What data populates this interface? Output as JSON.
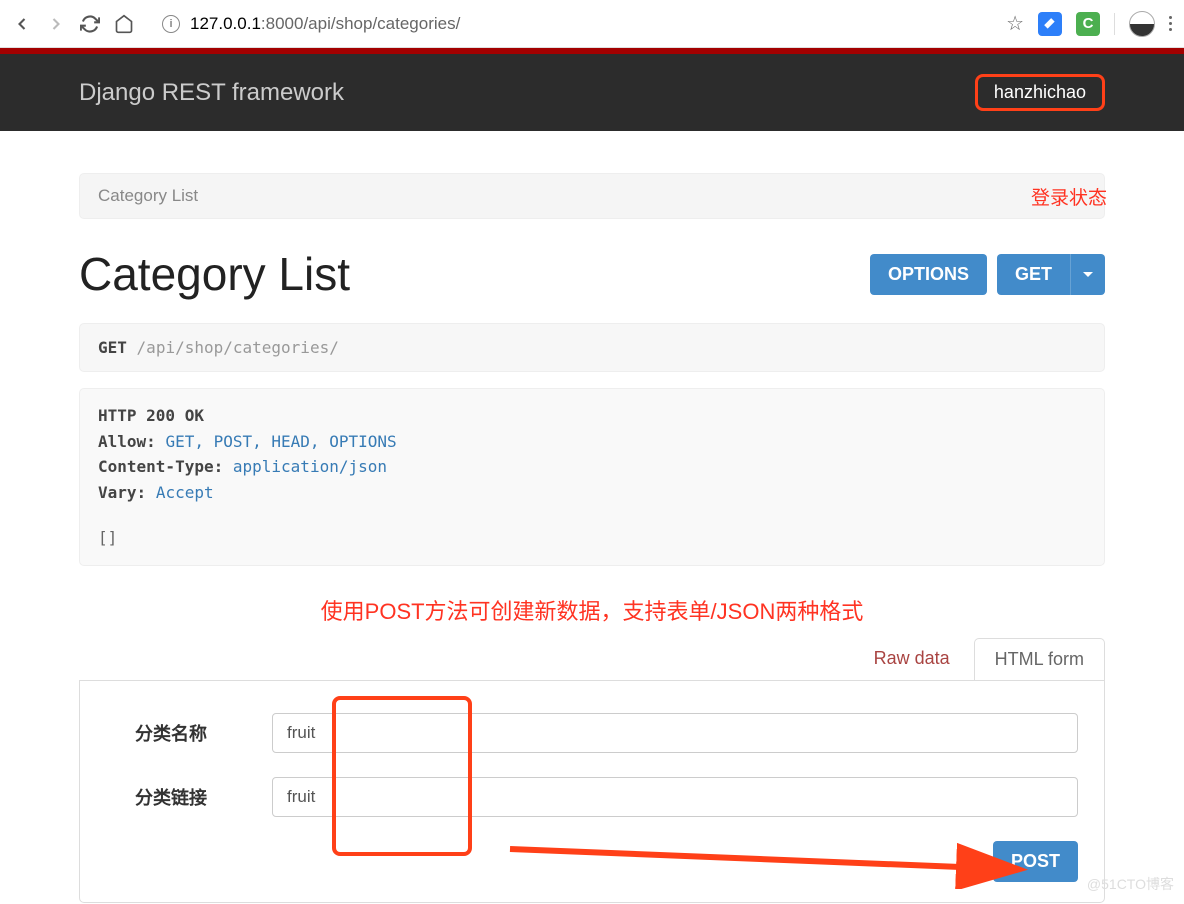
{
  "browser": {
    "url_plain": "127.0.0.1:8000/api/shop/categories/",
    "url_host": "127.0.0.1",
    "url_port": ":8000",
    "url_path": "/api/shop/categories/"
  },
  "header": {
    "brand": "Django REST framework",
    "username": "hanzhichao"
  },
  "annotations": {
    "login_status": "登录状态",
    "post_hint": "使用POST方法可创建新数据，支持表单/JSON两种格式"
  },
  "breadcrumb": {
    "label": "Category List"
  },
  "page": {
    "title": "Category List",
    "options_btn": "OPTIONS",
    "get_btn": "GET"
  },
  "request": {
    "method": "GET",
    "path": "/api/shop/categories/"
  },
  "response": {
    "status": "HTTP 200 OK",
    "allow_key": "Allow:",
    "allow_val": "GET, POST, HEAD, OPTIONS",
    "ctype_key": "Content-Type:",
    "ctype_val": "application/json",
    "vary_key": "Vary:",
    "vary_val": "Accept",
    "body": "[]"
  },
  "tabs": {
    "raw": "Raw data",
    "html": "HTML form"
  },
  "form": {
    "field1_label": "分类名称",
    "field1_value": "fruit",
    "field2_label": "分类链接",
    "field2_value": "fruit",
    "submit": "POST"
  },
  "watermark": "@51CTO博客"
}
